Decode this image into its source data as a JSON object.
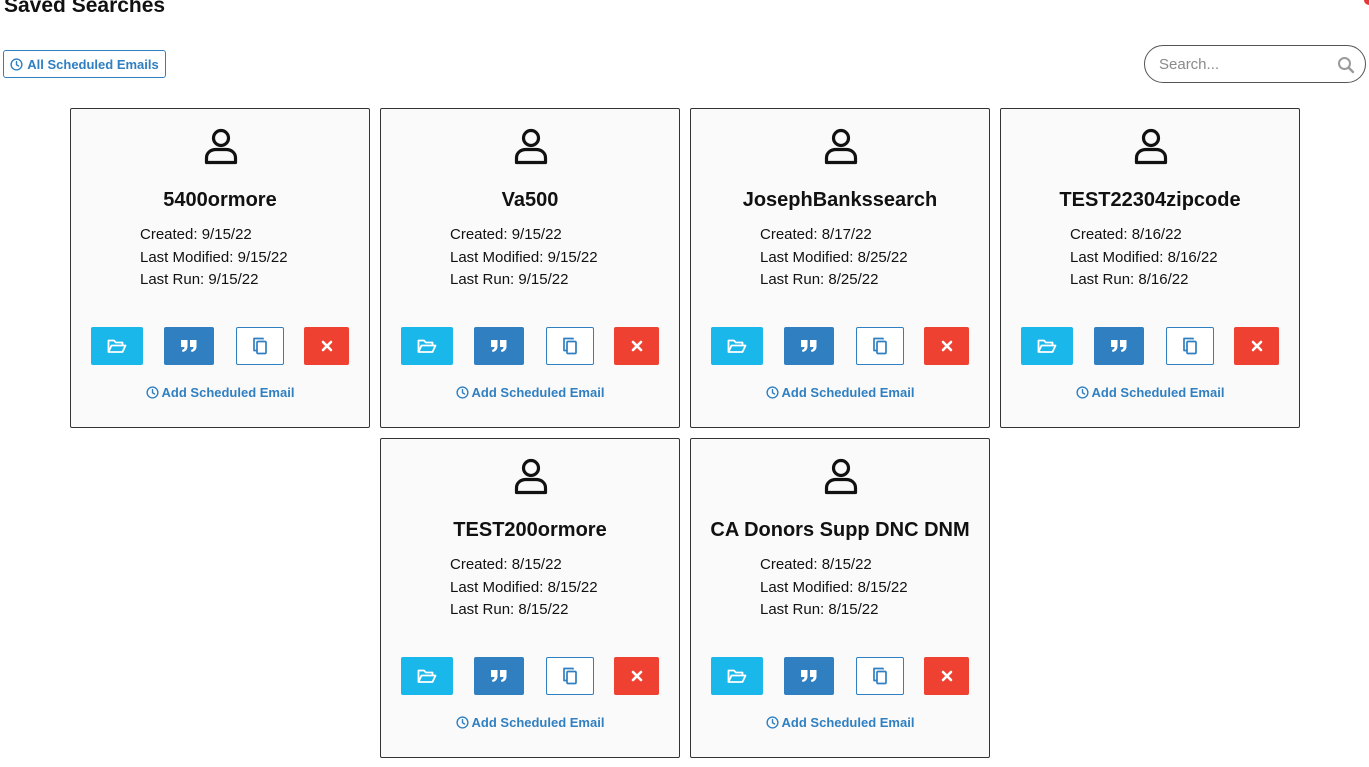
{
  "header": {
    "title": "Saved Searches"
  },
  "toolbar": {
    "scheduled_label": "All Scheduled Emails"
  },
  "search": {
    "placeholder": "Search...",
    "value": ""
  },
  "card_labels": {
    "created": "Created:",
    "last_modified": "Last Modified:",
    "last_run": "Last Run:",
    "add_scheduled": "Add Scheduled Email"
  },
  "cards": [
    {
      "name": "5400ormore",
      "created": "9/15/22",
      "last_modified": "9/15/22",
      "last_run": "9/15/22"
    },
    {
      "name": "Va500",
      "created": "9/15/22",
      "last_modified": "9/15/22",
      "last_run": "9/15/22"
    },
    {
      "name": "JosephBankssearch",
      "created": "8/17/22",
      "last_modified": "8/25/22",
      "last_run": "8/25/22"
    },
    {
      "name": "TEST22304zipcode",
      "created": "8/16/22",
      "last_modified": "8/16/22",
      "last_run": "8/16/22"
    },
    {
      "name": "TEST200ormore",
      "created": "8/15/22",
      "last_modified": "8/15/22",
      "last_run": "8/15/22"
    },
    {
      "name": "CA Donors Supp DNC DNM",
      "created": "8/15/22",
      "last_modified": "8/15/22",
      "last_run": "8/15/22"
    }
  ],
  "icons": {
    "avatar": "user-outline-icon",
    "open": "folder-open-icon",
    "quote": "quote-icon",
    "copy": "copy-icon",
    "delete": "close-icon",
    "clock": "clock-icon",
    "search": "search-icon"
  },
  "colors": {
    "primary": "#2f7fc1",
    "info": "#1ab7ea",
    "danger": "#ee4132",
    "card_bg": "#fafafa"
  }
}
